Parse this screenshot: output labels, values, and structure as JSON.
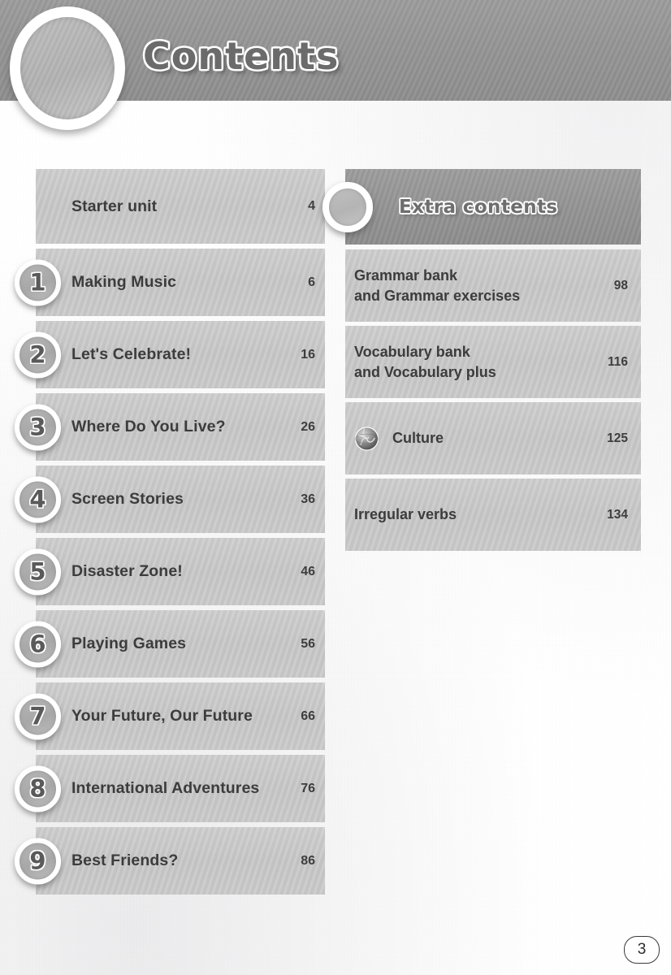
{
  "header": {
    "title": "Contents",
    "ring_icon": "circle-ring-icon"
  },
  "units": [
    {
      "number": "",
      "label": "Starter unit",
      "page": "4"
    },
    {
      "number": "1",
      "label": "Making Music",
      "page": "6"
    },
    {
      "number": "2",
      "label": "Let's Celebrate!",
      "page": "16"
    },
    {
      "number": "3",
      "label": "Where Do You Live?",
      "page": "26"
    },
    {
      "number": "4",
      "label": "Screen Stories",
      "page": "36"
    },
    {
      "number": "5",
      "label": "Disaster Zone!",
      "page": "46"
    },
    {
      "number": "6",
      "label": "Playing Games",
      "page": "56"
    },
    {
      "number": "7",
      "label": "Your Future, Our Future",
      "page": "66"
    },
    {
      "number": "8",
      "label": "International Adventures",
      "page": "76"
    },
    {
      "number": "9",
      "label": "Best Friends?",
      "page": "86"
    }
  ],
  "extra": {
    "title": "Extra contents",
    "ring_icon": "circle-ring-icon",
    "items": [
      {
        "line1": "Grammar bank",
        "line2": "and Grammar exercises",
        "page": "98",
        "icon": ""
      },
      {
        "line1": "Vocabulary bank",
        "line2": "and Vocabulary plus",
        "page": "116",
        "icon": ""
      },
      {
        "line1": "Culture",
        "line2": "",
        "page": "125",
        "icon": "globe-icon"
      },
      {
        "line1": "Irregular verbs",
        "line2": "",
        "page": "134",
        "icon": ""
      }
    ]
  },
  "footer": {
    "page_number": "3"
  },
  "colors": {
    "banner": "#959595",
    "row": "#c8c8c8",
    "text": "#3c3c3c",
    "white": "#ffffff"
  }
}
